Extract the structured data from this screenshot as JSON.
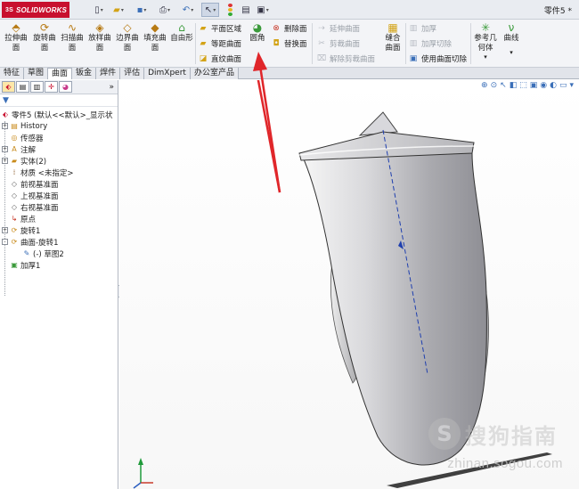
{
  "app": {
    "logo_prefix": "3S",
    "logo_text": "SOLIDWORKS",
    "document_title": "零件5 *"
  },
  "quick_access": [
    {
      "icon": "new-document-icon"
    },
    {
      "icon": "open-folder-icon"
    },
    {
      "icon": "save-icon"
    },
    {
      "icon": "print-icon"
    },
    {
      "icon": "undo-icon"
    },
    {
      "icon": "select-pointer-icon"
    },
    {
      "icon": "rebuild-traffic-light-icon"
    },
    {
      "icon": "file-properties-icon"
    },
    {
      "icon": "options-icon"
    }
  ],
  "ribbon": {
    "big_buttons": [
      {
        "label_1": "拉伸曲",
        "label_2": "面",
        "icon": "extruded-surface-icon"
      },
      {
        "label_1": "旋转曲",
        "label_2": "面",
        "icon": "revolved-surface-icon"
      },
      {
        "label_1": "扫描曲",
        "label_2": "面",
        "icon": "swept-surface-icon"
      },
      {
        "label_1": "放样曲",
        "label_2": "面",
        "icon": "lofted-surface-icon"
      },
      {
        "label_1": "边界曲",
        "label_2": "面",
        "icon": "boundary-surface-icon"
      },
      {
        "label_1": "填充曲",
        "label_2": "面",
        "icon": "filled-surface-icon"
      },
      {
        "label_1": "自由形",
        "label_2": "",
        "icon": "freeform-icon"
      }
    ],
    "group2": [
      {
        "label": "平面区域",
        "icon": "planar-surface-icon"
      },
      {
        "label": "等距曲面",
        "icon": "offset-surface-icon"
      },
      {
        "label": "直纹曲面",
        "icon": "ruled-surface-icon"
      }
    ],
    "fillet": {
      "label": "圆角",
      "icon": "fillet-icon"
    },
    "group3": [
      {
        "label": "删除面",
        "icon": "delete-face-icon"
      },
      {
        "label": "替换面",
        "icon": "replace-face-icon"
      }
    ],
    "group4": [
      {
        "label": "延伸曲面",
        "icon": "extend-surface-icon"
      },
      {
        "label": "剪裁曲面",
        "icon": "trim-surface-icon"
      },
      {
        "label": "解除剪裁曲面",
        "icon": "untrim-surface-icon"
      }
    ],
    "knit": {
      "label_1": "缝合",
      "label_2": "曲面",
      "icon": "knit-surface-icon"
    },
    "group5": [
      {
        "label": "加厚",
        "icon": "thicken-icon"
      },
      {
        "label": "加厚切除",
        "icon": "thicken-cut-icon"
      },
      {
        "label": "使用曲面切除",
        "icon": "surface-cut-icon"
      }
    ],
    "ref_geometry": {
      "label_1": "参考几",
      "label_2": "何体",
      "icon": "reference-geometry-icon"
    },
    "curves": {
      "label": "曲线",
      "icon": "curves-icon"
    }
  },
  "tabs": [
    {
      "label": "特征",
      "active": false
    },
    {
      "label": "草图",
      "active": false
    },
    {
      "label": "曲面",
      "active": true
    },
    {
      "label": "钣金",
      "active": false
    },
    {
      "label": "焊件",
      "active": false
    },
    {
      "label": "评估",
      "active": false
    },
    {
      "label": "DimXpert",
      "active": false
    },
    {
      "label": "办公室产品",
      "active": false
    }
  ],
  "feature_tree": {
    "root": "零件5 (默认<<默认>_显示状",
    "nodes": [
      {
        "label": "History",
        "icon": "history-folder-icon",
        "expander": "+",
        "indent": 1
      },
      {
        "label": "传感器",
        "icon": "sensors-icon",
        "expander": "",
        "indent": 1
      },
      {
        "label": "注解",
        "icon": "annotations-icon",
        "expander": "+",
        "indent": 1
      },
      {
        "label": "实体(2)",
        "icon": "solid-bodies-folder-icon",
        "expander": "+",
        "indent": 1
      },
      {
        "label": "材质 <未指定>",
        "icon": "material-icon",
        "expander": "",
        "indent": 1
      },
      {
        "label": "前视基准面",
        "icon": "front-plane-icon",
        "expander": "",
        "indent": 1
      },
      {
        "label": "上视基准面",
        "icon": "top-plane-icon",
        "expander": "",
        "indent": 1
      },
      {
        "label": "右视基准面",
        "icon": "right-plane-icon",
        "expander": "",
        "indent": 1
      },
      {
        "label": "原点",
        "icon": "origin-icon",
        "expander": "",
        "indent": 1
      },
      {
        "label": "旋转1",
        "icon": "revolve-feature-icon",
        "expander": "+",
        "indent": 1
      },
      {
        "label": "曲面-旋转1",
        "icon": "surface-revolve-feature-icon",
        "expander": "-",
        "indent": 1
      },
      {
        "label": "(-) 草图2",
        "icon": "sketch-icon",
        "expander": "",
        "indent": 2
      },
      {
        "label": "加厚1",
        "icon": "thicken-feature-icon",
        "expander": "",
        "indent": 1
      }
    ]
  },
  "watermark": {
    "logo_char": "S",
    "text": "搜狗指南",
    "url": "zhinan.sogou.com"
  }
}
